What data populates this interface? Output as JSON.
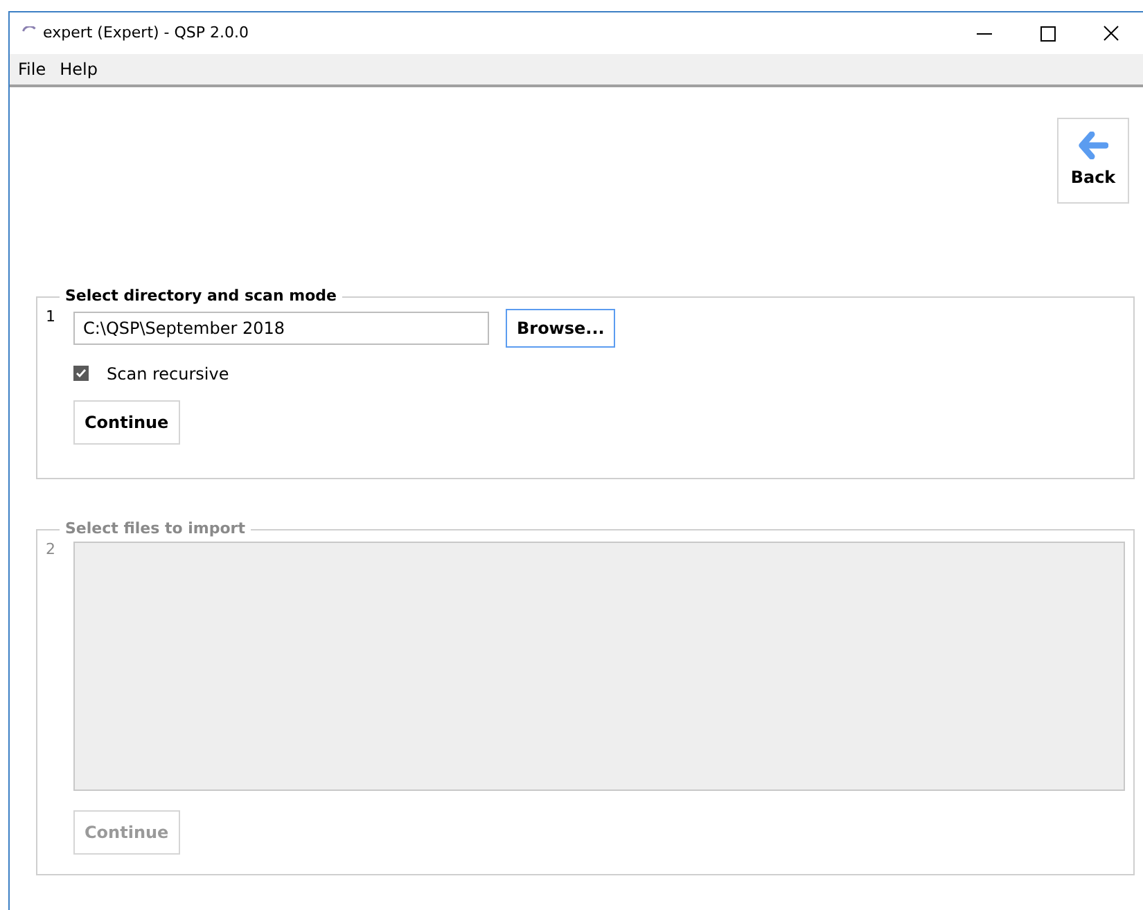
{
  "window": {
    "title": "expert (Expert) - QSP 2.0.0"
  },
  "menu": [
    {
      "label": "File"
    },
    {
      "label": "Help"
    }
  ],
  "back_button": {
    "label": "Back"
  },
  "step1": {
    "number": "1",
    "title": "Select directory and scan mode",
    "path": "C:\\QSP\\September 2018",
    "browse": "Browse...",
    "scan_recursive": {
      "label": "Scan recursive",
      "checked": true
    },
    "continue": {
      "label": "Continue",
      "disabled": false
    }
  },
  "step2": {
    "number": "2",
    "title": "Select files to import",
    "disabled": true,
    "continue": {
      "label": "Continue",
      "disabled": true
    }
  }
}
